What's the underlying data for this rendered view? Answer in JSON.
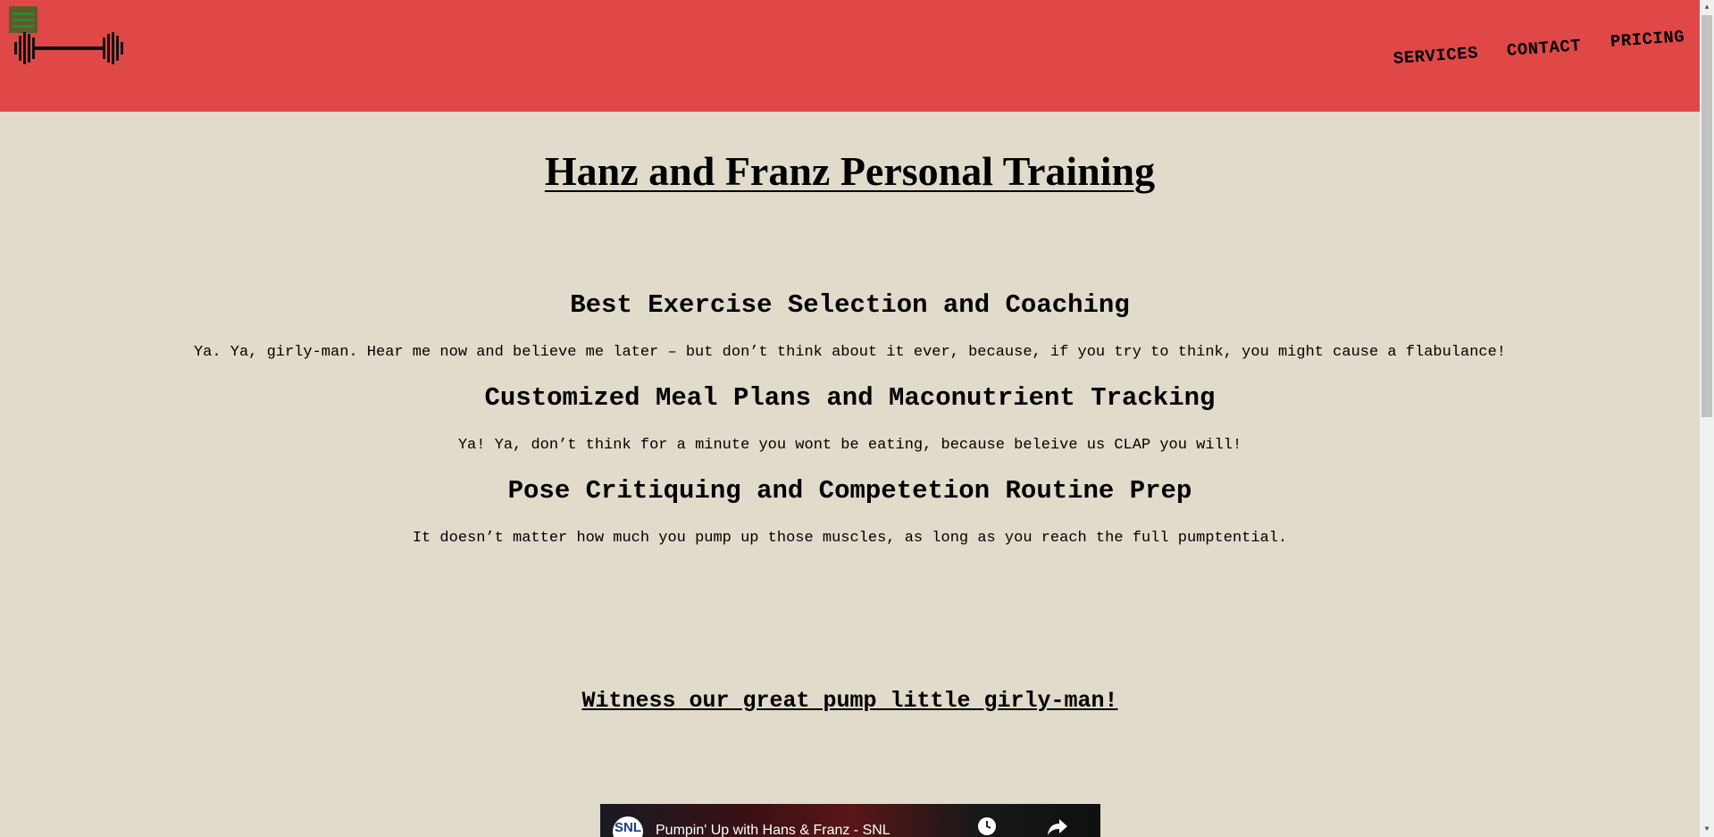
{
  "header": {
    "menu_icon": "hamburger-icon",
    "logo_icon": "barbell-icon",
    "nav": [
      {
        "label": "SERVICES"
      },
      {
        "label": "CONTACT"
      },
      {
        "label": "PRICING"
      }
    ]
  },
  "main": {
    "title": "Hanz and Franz Personal Training",
    "sections": [
      {
        "heading": "Best Exercise Selection and Coaching",
        "text": "Ya. Ya, girly-man. Hear me now and believe me later – but don’t think about it ever, because, if you try to think, you might cause a flabulance!"
      },
      {
        "heading": "Customized Meal Plans and Maconutrient Tracking",
        "text": "Ya! Ya, don’t think for a minute you wont be eating, because beleive us CLAP you will!"
      },
      {
        "heading": "Pose Critiquing and Competetion Routine Prep",
        "text": "It doesn’t matter how much you pump up those muscles, as long as you reach the full pumptential."
      },
      {
        "heading": "",
        "text": ""
      }
    ],
    "witness_link": "Witness our great pump little girly-man!"
  },
  "video": {
    "title": "Pumpin' Up with Hans & Franz - SNL",
    "channel_logo": "SNL",
    "clock_icon": "clock-icon",
    "share_icon": "share-icon"
  },
  "colors": {
    "header_bg": "#df4847",
    "page_bg": "#e0dbca"
  }
}
